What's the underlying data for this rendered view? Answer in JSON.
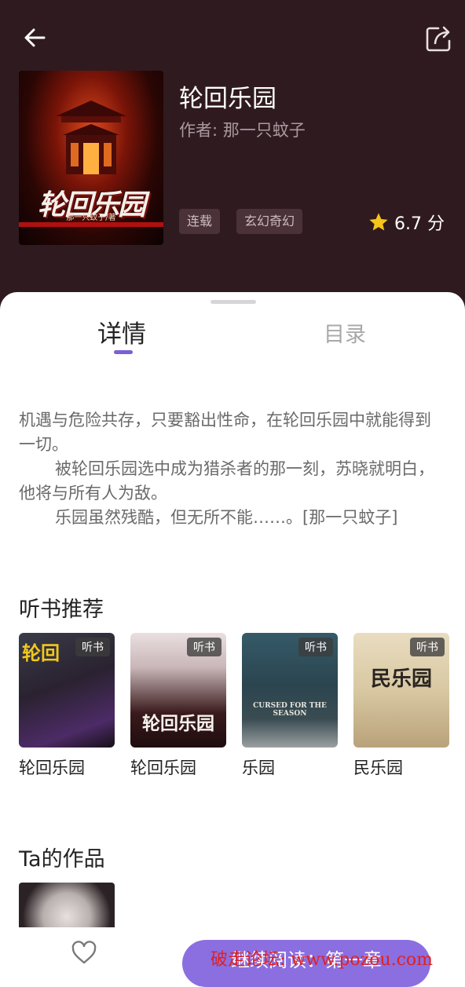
{
  "header": {
    "back_icon": "arrow-left-icon",
    "share_icon": "share-icon"
  },
  "book": {
    "title": "轮回乐园",
    "author": "作者: 那一只蚊子",
    "cover_title": "轮回乐园",
    "cover_author": "那一只蚊子/著",
    "tags": [
      "连载",
      "玄幻奇幻"
    ],
    "rating": "6.7 分"
  },
  "tabs": {
    "details": "详情",
    "toc": "目录"
  },
  "synopsis": {
    "p1": "机遇与危险共存，只要豁出性命，在轮回乐园中就能得到一切。",
    "p2": "被轮回乐园选中成为猎杀者的那一刻，苏晓就明白，他将与所有人为敌。",
    "p3": "乐园虽然残酷，但无所不能……。[那一只蚊子]"
  },
  "recommend": {
    "title": "听书推荐",
    "badge": "听书",
    "items": [
      {
        "title": "轮回乐园",
        "cover_text": "轮回"
      },
      {
        "title": "轮回乐园",
        "cover_text": "轮回乐园"
      },
      {
        "title": "乐园",
        "cover_text": "CURSED FOR THE SEASON"
      },
      {
        "title": "民乐园",
        "cover_text": "民乐园"
      }
    ]
  },
  "works": {
    "title": "Ta的作品"
  },
  "bottom": {
    "favorite_icon": "heart-icon",
    "read_label": "继续阅读：第一章"
  },
  "watermark": "破走论坛: www.pozou.com",
  "colors": {
    "header_bg": "#2f1a20",
    "accent": "#7b5fd6",
    "star": "#f5c518"
  }
}
